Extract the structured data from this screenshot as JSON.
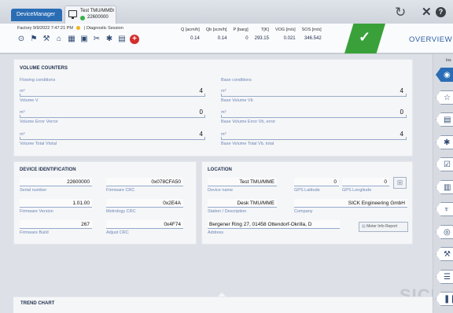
{
  "tabs": {
    "app_tab": "DeviceManager",
    "device_tab_title": "Test TMU/MME",
    "device_tab_serial": "22600000",
    "close_glyph": "x"
  },
  "toolbar": {
    "refresh_icon": "refresh-icon",
    "tools_glyph": "✕",
    "help_glyph": "?"
  },
  "status": {
    "factory_label": "Factory",
    "datetime": "9/9/2022 7:47:21 PM",
    "session": "| Diagnostic Session",
    "status_color": "#f2b41c",
    "icons": [
      "display-icon",
      "anemometer-icon",
      "tools-icon",
      "network-icon",
      "calculator-icon",
      "log-icon",
      "tools-cross-icon",
      "settings-icon",
      "document-icon",
      "alarm-icon"
    ],
    "measurements": [
      {
        "label": "Q [acm/h]",
        "value": "0.14"
      },
      {
        "label": "Qb [scm/h]",
        "value": "0.14"
      },
      {
        "label": "P [barg]",
        "value": "0"
      },
      {
        "label": "T[K]",
        "value": "293.15"
      },
      {
        "label": "VOG [m/s]",
        "value": "0.021"
      },
      {
        "label": "SOS [m/s]",
        "value": "346.542"
      }
    ],
    "ok_color": "#3aa13a",
    "ok_glyph": "✓",
    "overview": "OVERVIEW"
  },
  "volume": {
    "title": "VOLUME COUNTERS",
    "flowing": "Flowing conditions",
    "base": "Base conditions",
    "unit": "m³",
    "rows": [
      {
        "left_value": "4",
        "left_label": "Volume V",
        "right_value": "4",
        "right_label": "Base Volume Vb"
      },
      {
        "left_value": "0",
        "left_label": "Volume Error Verror",
        "right_value": "0",
        "right_label": "Base Volume Error Vb, error"
      },
      {
        "left_value": "4",
        "left_label": "Volume Total Vtotal",
        "right_value": "4",
        "right_label": "Base Volume Total Vb, total"
      }
    ]
  },
  "device": {
    "title": "DEVICE IDENTIFICATION",
    "serial_value": "22600000",
    "serial_label": "Serial number",
    "fw_crc_value": "0x078CFA50",
    "fw_crc_label": "Firmware CRC",
    "fw_version_value": "1.01.00",
    "fw_version_label": "Firmware Version",
    "metrology_value": "0x2E4A",
    "metrology_label": "Metrology CRC",
    "fw_build_value": "267",
    "fw_build_label": "Firmware Build",
    "adjust_value": "0x4F74",
    "adjust_label": "Adjust CRC"
  },
  "location": {
    "title": "LOCATION",
    "device_name_value": "Test TMU/MME",
    "device_name_label": "Device name",
    "gps_lat_value": "0",
    "gps_lat_label": "GPS Latitude",
    "gps_long_value": "0",
    "gps_long_label": "GPS Longitude",
    "station_value": "Desk TMU/MME",
    "station_label": "Station / Description",
    "company_value": "SICK Engineering GmbH",
    "company_label": "Company",
    "address_value": "Bergener Ring 27, 01458 Ottendorf-Okrilla, D",
    "address_label": "Address",
    "report_button": "Meter Info Report"
  },
  "sidebar": {
    "label": "Ins",
    "items": [
      "gauge-icon",
      "star-icon",
      "report-icon",
      "settings-icon",
      "checklist-icon",
      "book-icon",
      "diagnosis-icon",
      "sensor-icon",
      "wrench-icon",
      "list-icon",
      "pause-icon"
    ]
  },
  "brand": "SICK",
  "trend": {
    "title": "TREND CHART"
  }
}
